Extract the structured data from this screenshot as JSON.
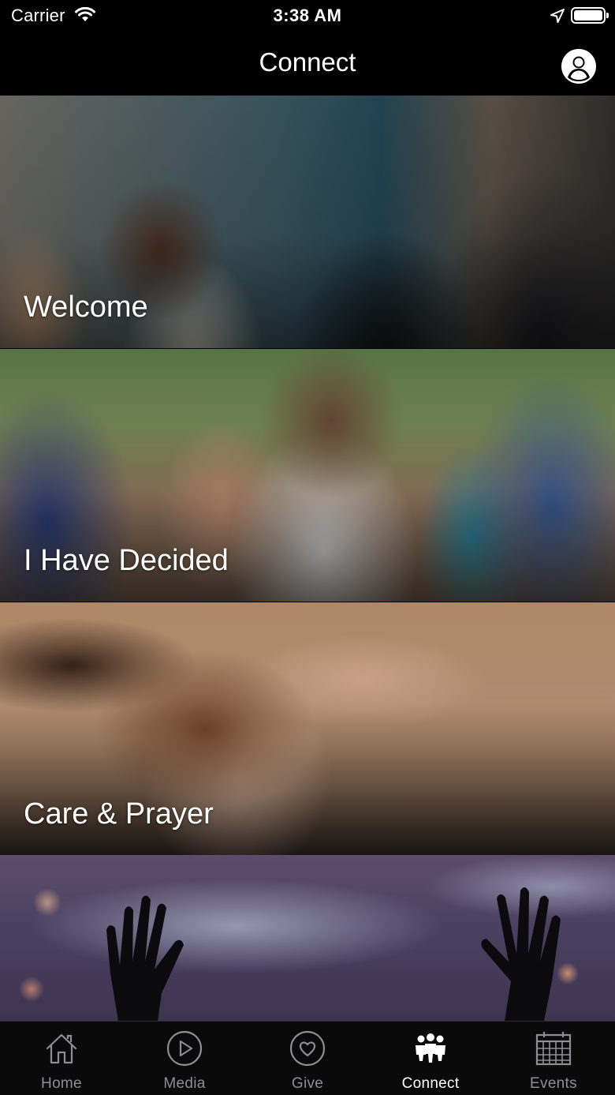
{
  "status_bar": {
    "carrier": "Carrier",
    "time": "3:38 AM"
  },
  "nav": {
    "title": "Connect",
    "profile_icon": "person-circle-icon"
  },
  "cards": [
    {
      "label": "Welcome",
      "image": "people-mingling-coffee"
    },
    {
      "label": "I Have Decided",
      "image": "group-laughing-outdoors"
    },
    {
      "label": "Care & Prayer",
      "image": "hands-stacked-together"
    },
    {
      "label": "",
      "image": "raised-hands-worship"
    }
  ],
  "tabs": [
    {
      "label": "Home",
      "icon": "home-icon",
      "active": false
    },
    {
      "label": "Media",
      "icon": "play-circle-icon",
      "active": false
    },
    {
      "label": "Give",
      "icon": "heart-circle-icon",
      "active": false
    },
    {
      "label": "Connect",
      "icon": "people-group-icon",
      "active": true
    },
    {
      "label": "Events",
      "icon": "calendar-icon",
      "active": false
    }
  ],
  "colors": {
    "background": "#000000",
    "tab_inactive": "#8e8e93",
    "tab_active": "#ffffff"
  }
}
